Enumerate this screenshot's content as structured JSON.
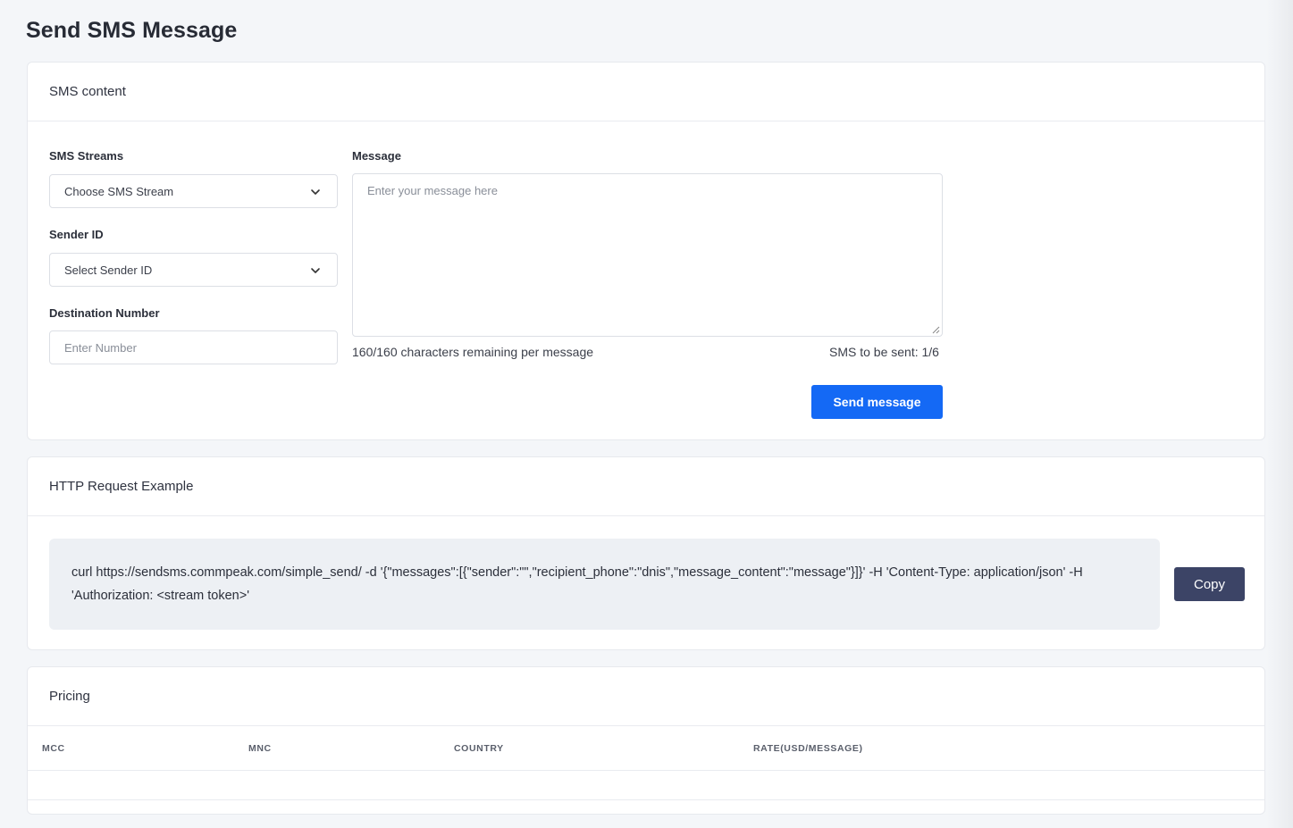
{
  "page": {
    "title": "Send SMS Message"
  },
  "sms_card": {
    "header": "SMS content",
    "streams_label": "SMS Streams",
    "streams_value": "Choose SMS Stream",
    "sender_label": "Sender ID",
    "sender_value": "Select Sender ID",
    "destination_label": "Destination Number",
    "destination_placeholder": "Enter Number",
    "message_label": "Message",
    "message_placeholder": "Enter your message here",
    "chars_remaining": "160/160 characters remaining per message",
    "sms_count": "SMS to be sent: 1/6",
    "send_label": "Send message"
  },
  "http_card": {
    "header": "HTTP Request Example",
    "code": "curl https://sendsms.commpeak.com/simple_send/ -d '{\"messages\":[{\"sender\":\"\",\"recipient_phone\":\"dnis\",\"message_content\":\"message\"}]}' -H 'Content-Type: application/json' -H 'Authorization: <stream token>'",
    "copy_label": "Copy"
  },
  "pricing_card": {
    "header": "Pricing",
    "columns": [
      "MCC",
      "MNC",
      "COUNTRY",
      "RATE(USD/MESSAGE)"
    ],
    "rows": []
  },
  "colors": {
    "primary": "#1469f5",
    "copy_button": "#3c4466",
    "background": "#f4f6f9"
  },
  "icons": {
    "select_arrow": "chevron-down-icon",
    "resize": "resize-grip-icon"
  }
}
